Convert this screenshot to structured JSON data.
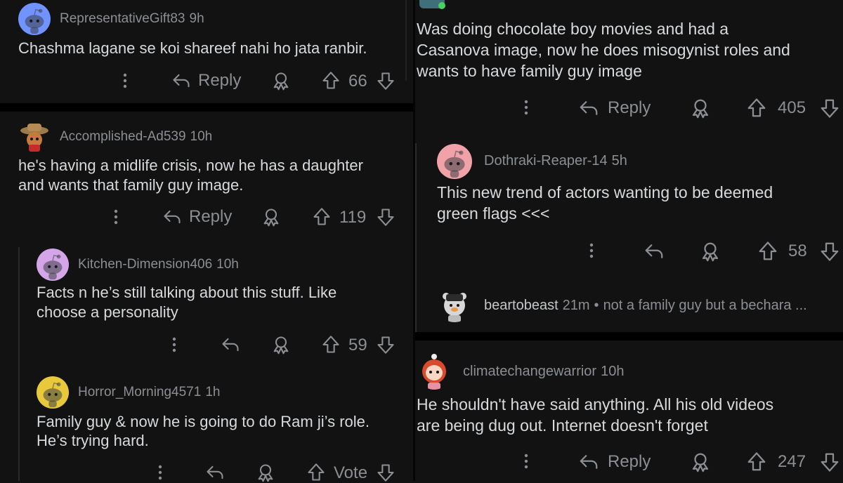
{
  "colors": {
    "background": "#121212",
    "divider": "#000000",
    "text": "#d7dadc",
    "muted": "#8b8f93"
  },
  "left": {
    "comments": [
      {
        "username": "RepresentativeGift83",
        "time": "9h",
        "lines": [
          "Chashma lagane se koi shareef nahi ho jata ranbir."
        ],
        "reply_label": "Reply",
        "votes": "66",
        "avatar": "snoo-blue"
      },
      {
        "username": "Accomplished-Ad539",
        "time": "10h",
        "lines": [
          "he's having a midlife crisis, now he has a daughter",
          "and wants that family guy image."
        ],
        "reply_label": "Reply",
        "votes": "119",
        "avatar": "snoo-cowboy"
      },
      {
        "username": "Kitchen-Dimension406",
        "time": "10h",
        "lines": [
          "Facts n he’s still talking about this stuff. Like",
          "choose a personality"
        ],
        "votes": "59",
        "avatar": "snoo-purple"
      },
      {
        "username": "Horror_Morning4571",
        "time": "1h",
        "lines": [
          "Family guy & now he is going to do Ram ji’s role.",
          "He’s trying hard."
        ],
        "votes": "Vote",
        "avatar": "snoo-yellow"
      }
    ]
  },
  "right": {
    "comments": [
      {
        "lines": [
          "Was doing chocolate boy movies and had a",
          "Casanova image, now he does misogynist roles and",
          "wants to have family guy  image"
        ],
        "reply_label": "Reply",
        "votes": "405",
        "avatar": "snoo-robot"
      },
      {
        "username": "Dothraki-Reaper-14",
        "time": "5h",
        "lines": [
          "This new trend of actors wanting to be deemed",
          "green flags <<<"
        ],
        "votes": "58",
        "avatar": "snoo-pink"
      },
      {
        "username": "beartobeast",
        "time": "21m",
        "preview": "not a family guy but a bechara ...",
        "avatar": "snoo-bear"
      },
      {
        "username": "climatechangewarrior",
        "time": "10h",
        "lines": [
          "He shouldn't have said anything. All his old videos",
          "are being dug out. Internet doesn't forget"
        ],
        "reply_label": "Reply",
        "votes": "247",
        "avatar": "snoo-redhair"
      }
    ]
  }
}
